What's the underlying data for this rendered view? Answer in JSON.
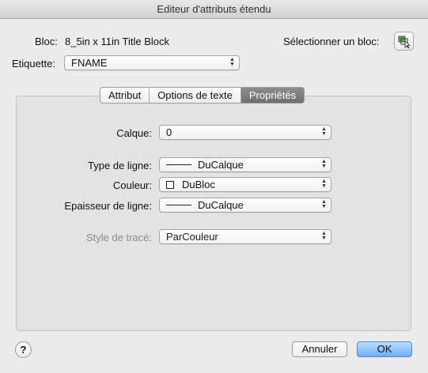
{
  "window": {
    "title": "Editeur d'attributs étendu"
  },
  "block": {
    "label": "Bloc:",
    "name": "8_5in x 11in Title Block",
    "select_label": "Sélectionner un bloc:"
  },
  "tag": {
    "label": "Etiquette:",
    "value": "FNAME"
  },
  "tabs": [
    {
      "label": "Attribut",
      "active": false
    },
    {
      "label": "Options de texte",
      "active": false
    },
    {
      "label": "Propriétés",
      "active": true
    }
  ],
  "properties": {
    "layer": {
      "label": "Calque:",
      "value": "0"
    },
    "linetype": {
      "label": "Type de ligne:",
      "value": "DuCalque"
    },
    "color": {
      "label": "Couleur:",
      "value": "DuBloc"
    },
    "lineweight": {
      "label": "Epaisseur de ligne:",
      "value": "DuCalque"
    },
    "plotstyle": {
      "label": "Style de tracé:",
      "value": "ParCouleur",
      "enabled": false
    }
  },
  "footer": {
    "help": "?",
    "cancel": "Annuler",
    "ok": "OK"
  },
  "icons": {
    "pick_block": "select-block-icon",
    "arrows": "popup-arrows-icon"
  }
}
